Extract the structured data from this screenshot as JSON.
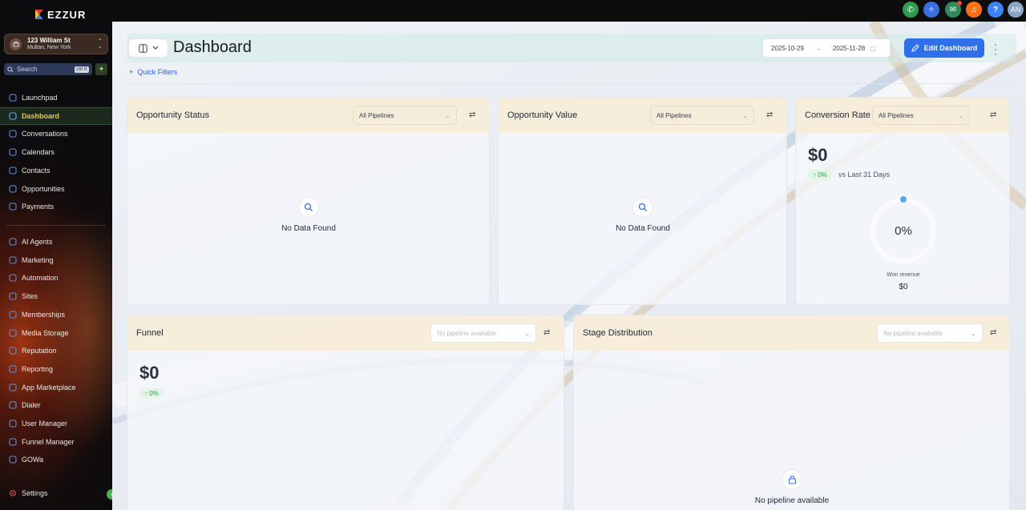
{
  "brand": {
    "name": "EZZUR"
  },
  "location": {
    "title": "123 William St",
    "subtitle": "Multan, New York"
  },
  "search": {
    "placeholder": "Search",
    "shortcut": "ctrl K"
  },
  "sidebar": {
    "items": [
      {
        "label": "Launchpad",
        "icon": "launchpad-icon"
      },
      {
        "label": "Dashboard",
        "icon": "dashboard-icon",
        "active": true
      },
      {
        "label": "Conversations",
        "icon": "chat-icon"
      },
      {
        "label": "Calendars",
        "icon": "calendar-icon"
      },
      {
        "label": "Contacts",
        "icon": "contacts-icon"
      },
      {
        "label": "Opportunities",
        "icon": "opportunities-icon"
      },
      {
        "label": "Payments",
        "icon": "payments-icon"
      }
    ],
    "items2": [
      {
        "label": "AI Agents",
        "icon": "ai-agents-icon"
      },
      {
        "label": "Marketing",
        "icon": "marketing-icon"
      },
      {
        "label": "Automation",
        "icon": "automation-icon"
      },
      {
        "label": "Sites",
        "icon": "sites-icon"
      },
      {
        "label": "Memberships",
        "icon": "memberships-icon"
      },
      {
        "label": "Media Storage",
        "icon": "media-storage-icon"
      },
      {
        "label": "Reputation",
        "icon": "reputation-icon"
      },
      {
        "label": "Reporting",
        "icon": "reporting-icon"
      },
      {
        "label": "App Marketplace",
        "icon": "app-marketplace-icon"
      },
      {
        "label": "Dialer",
        "icon": "dialer-icon"
      },
      {
        "label": "User Manager",
        "icon": "user-manager-icon"
      },
      {
        "label": "Funnel Manager",
        "icon": "funnel-manager-icon"
      },
      {
        "label": "GOWa",
        "icon": "gowa-icon"
      }
    ],
    "settings": "Settings"
  },
  "topbar": {
    "avatar": "AN",
    "help": "?"
  },
  "header": {
    "title": "Dashboard",
    "date_start": "2025-10-29",
    "date_end": "2025-11-28",
    "edit_label": "Edit Dashboard",
    "quick_filters": "Quick Filters"
  },
  "cards": {
    "opp_status": {
      "title": "Opportunity Status",
      "select": "All Pipelines",
      "empty": "No Data Found"
    },
    "opp_value": {
      "title": "Opportunity Value",
      "select": "All Pipelines",
      "empty": "No Data Found"
    },
    "conversion": {
      "title": "Conversion Rate",
      "select": "All Pipelines",
      "value": "$0",
      "change": "0%",
      "compare": "vs Last 31 Days",
      "gauge": "0%",
      "gauge_fraction": 0,
      "won_label": "Won revenue",
      "won_value": "$0"
    },
    "funnel": {
      "title": "Funnel",
      "select": "No pipeline available",
      "value": "$0",
      "change": "0%"
    },
    "stage": {
      "title": "Stage Distribution",
      "select": "No pipeline available",
      "empty": "No pipeline available"
    }
  },
  "colors": {
    "accent": "#2f6fea",
    "active_nav": "#f5c542",
    "positive": "#27a148"
  }
}
